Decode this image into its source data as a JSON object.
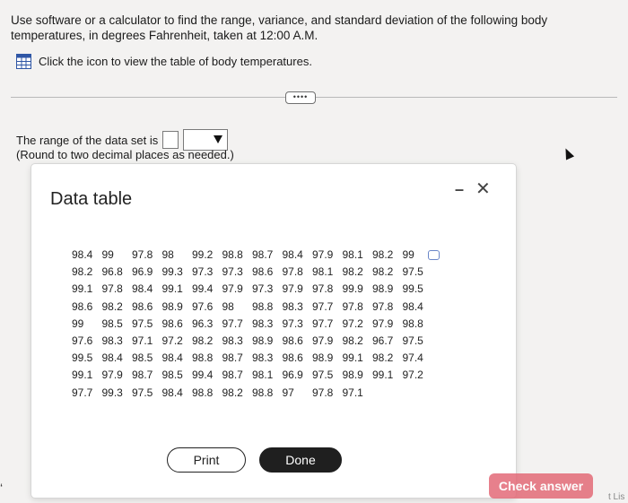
{
  "question": {
    "text": "Use software or a calculator to find the range, variance, and standard deviation of the following body temperatures, in degrees Fahrenheit, taken at 12:00 A.M."
  },
  "icon_prompt": {
    "text": "Click the icon to view the table of body temperatures."
  },
  "expand_button": {
    "label": "••••"
  },
  "answer": {
    "prompt": "The range of the data set is",
    "note": "(Round to two decimal places as needed.)"
  },
  "modal": {
    "title": "Data table",
    "rows": [
      [
        "98.4",
        "99",
        "97.8",
        "98",
        "99.2",
        "98.8",
        "98.7",
        "98.4",
        "97.9",
        "98.1",
        "98.2",
        "99"
      ],
      [
        "98.2",
        "96.8",
        "96.9",
        "99.3",
        "97.3",
        "97.3",
        "98.6",
        "97.8",
        "98.1",
        "98.2",
        "98.2",
        "97.5"
      ],
      [
        "99.1",
        "97.8",
        "98.4",
        "99.1",
        "99.4",
        "97.9",
        "97.3",
        "97.9",
        "97.8",
        "99.9",
        "98.9",
        "99.5"
      ],
      [
        "98.6",
        "98.2",
        "98.6",
        "98.9",
        "97.6",
        "98",
        "98.8",
        "98.3",
        "97.7",
        "97.8",
        "97.8",
        "98.4"
      ],
      [
        "99",
        "98.5",
        "97.5",
        "98.6",
        "96.3",
        "97.7",
        "98.3",
        "97.3",
        "97.7",
        "97.2",
        "97.9",
        "98.8"
      ],
      [
        "97.6",
        "98.3",
        "97.1",
        "97.2",
        "98.2",
        "98.3",
        "98.9",
        "98.6",
        "97.9",
        "98.2",
        "96.7",
        "97.5"
      ],
      [
        "99.5",
        "98.4",
        "98.5",
        "98.4",
        "98.8",
        "98.7",
        "98.3",
        "98.6",
        "98.9",
        "99.1",
        "98.2",
        "97.4"
      ],
      [
        "99.1",
        "97.9",
        "98.7",
        "98.5",
        "99.4",
        "98.7",
        "98.1",
        "96.9",
        "97.5",
        "98.9",
        "99.1",
        "97.2"
      ],
      [
        "97.7",
        "99.3",
        "97.5",
        "98.4",
        "98.8",
        "98.2",
        "98.8",
        "97",
        "97.8",
        "97.1"
      ]
    ],
    "print_label": "Print",
    "done_label": "Done",
    "minimize_glyph": "–",
    "close_glyph": "✕"
  },
  "check_answer": {
    "label": "Check answer"
  },
  "edge": {
    "left_glyph": "‘",
    "corner_text": "t Lis"
  }
}
